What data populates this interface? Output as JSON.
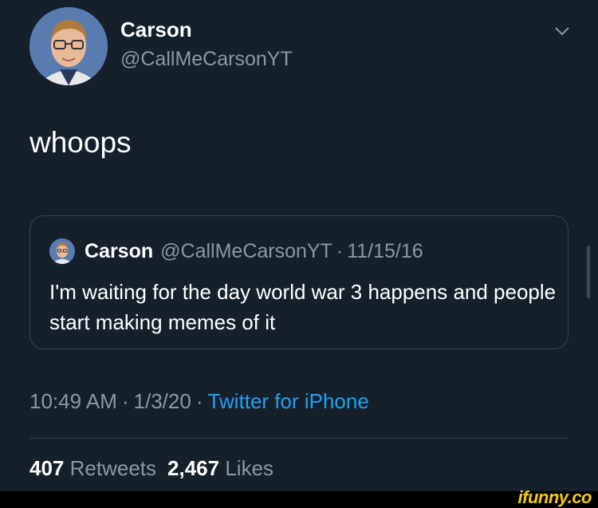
{
  "tweet": {
    "author_name": "Carson",
    "author_handle": "@CallMeCarsonYT",
    "text": "whoops",
    "quoted": {
      "author_name": "Carson",
      "author_handle": "@CallMeCarsonYT",
      "separator": "·",
      "date": "11/15/16",
      "text": "I'm waiting for the day world war 3 happens and people start making memes of it"
    },
    "time": "10:49 AM",
    "date": "1/3/20",
    "separator": "·",
    "source": "Twitter for iPhone",
    "retweets_count": "407",
    "retweets_label": "Retweets",
    "likes_count": "2,467",
    "likes_label": "Likes"
  },
  "icons": {
    "menu": "chevron-down-icon",
    "avatar": "avatar-photo"
  },
  "watermark": "ifunny.co",
  "colors": {
    "background": "#15202b",
    "secondary_text": "#8899a6",
    "link": "#1da1f2",
    "border": "#38444d",
    "watermark": "#f6c90e"
  }
}
